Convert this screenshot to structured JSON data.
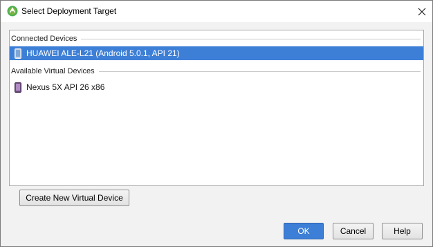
{
  "window": {
    "title": "Select Deployment Target",
    "icon": "android-studio-icon"
  },
  "device_list": {
    "groups": [
      {
        "header": "Connected Devices",
        "devices": [
          {
            "label": "HUAWEI ALE-L21 (Android 5.0.1, API 21)",
            "icon": "phone-icon",
            "selected": true
          }
        ]
      },
      {
        "header": "Available Virtual Devices",
        "devices": [
          {
            "label": "Nexus 5X API 26 x86",
            "icon": "virtual-phone-icon",
            "selected": false
          }
        ]
      }
    ]
  },
  "buttons": {
    "create_virtual_device": "Create New Virtual Device",
    "ok": "OK",
    "cancel": "Cancel",
    "help": "Help"
  },
  "colors": {
    "selection": "#3d7fd6",
    "accent": "#3d7fd6",
    "android_green": "#7cb342"
  }
}
